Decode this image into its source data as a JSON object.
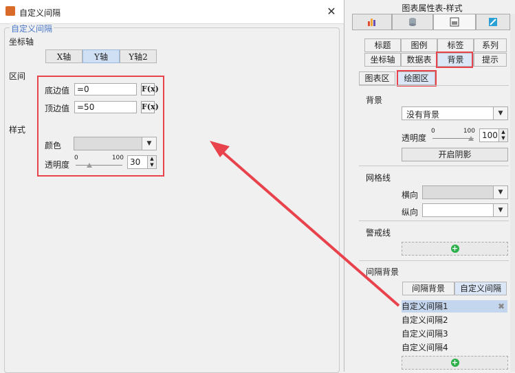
{
  "dialog": {
    "title": "自定义间隔",
    "close_glyph": "✕",
    "group_title": "自定义间隔",
    "axis_label": "坐标轴",
    "axis_tabs": [
      "X轴",
      "Y轴",
      "Y轴2"
    ],
    "selected_axis": "Y轴",
    "interval_label": "区间",
    "style_label": "样式",
    "bottom_label": "底边值",
    "bottom_value": "=0",
    "top_label": "顶边值",
    "top_value": "=50",
    "fx_label": "F(x)",
    "color_label": "颜色",
    "transparency_label": "透明度",
    "slider_min": "0",
    "slider_max": "100",
    "transparency_value": "30"
  },
  "panel": {
    "title": "图表属性表-样式",
    "top_tabs": [
      "chart-type-icon",
      "data-icon",
      "style-icon",
      "special-effects-icon"
    ],
    "style_tabs_row1": [
      "标题",
      "图例",
      "标签",
      "系列"
    ],
    "style_tabs_row2": [
      "坐标轴",
      "数据表",
      "背景",
      "提示"
    ],
    "selected_style_tab": "背景",
    "area_tabs": [
      "图表区",
      "绘图区"
    ],
    "selected_area_tab": "绘图区",
    "background_label": "背景",
    "background_value": "没有背景",
    "transparency_label": "透明度",
    "slider_min": "0",
    "slider_max": "100",
    "transparency_value": "100",
    "shadow_button": "开启阴影",
    "gridlines_label": "网格线",
    "horizontal_label": "横向",
    "vertical_label": "纵向",
    "alert_line_label": "警戒线",
    "interval_bg_label": "间隔背景",
    "interval_tabs": [
      "间隔背景",
      "自定义间隔"
    ],
    "selected_interval_tab": "自定义间隔",
    "intervals": [
      "自定义间隔1",
      "自定义间隔2",
      "自定义间隔3",
      "自定义间隔4"
    ],
    "delete_glyph": "✖",
    "add_glyph": "+"
  },
  "colors": {
    "annotation_red": "#e8434c",
    "group_title_blue": "#4a78c9",
    "add_green": "#2db04b",
    "selected_row": "#c4d6ed"
  }
}
